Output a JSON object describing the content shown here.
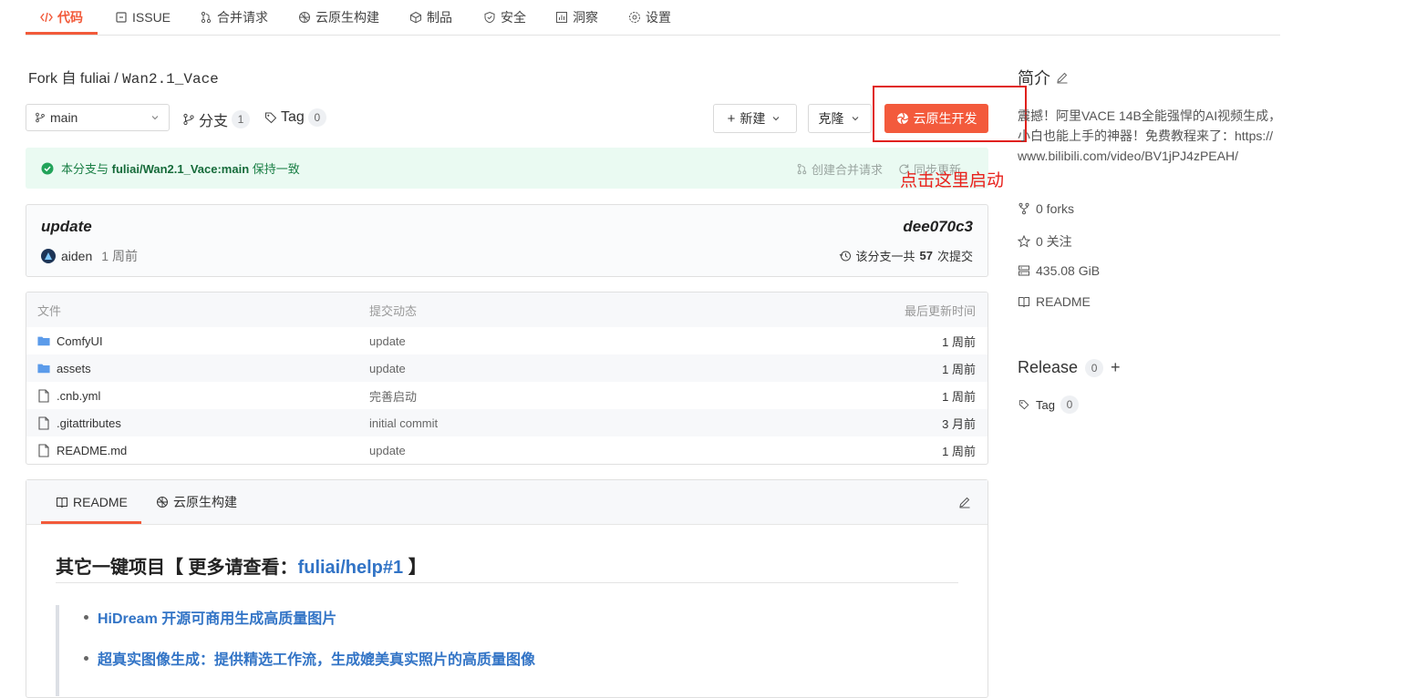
{
  "tabs": [
    {
      "label": "代码",
      "icon": "code-icon"
    },
    {
      "label": "ISSUE",
      "icon": "issue-icon"
    },
    {
      "label": "合并请求",
      "icon": "pull-request-icon"
    },
    {
      "label": "云原生构建",
      "icon": "build-icon"
    },
    {
      "label": "制品",
      "icon": "package-icon"
    },
    {
      "label": "安全",
      "icon": "shield-icon"
    },
    {
      "label": "洞察",
      "icon": "chart-icon"
    },
    {
      "label": "设置",
      "icon": "gear-icon"
    }
  ],
  "repo": {
    "fork_prefix": "Fork 自 ",
    "owner": "fuliai",
    "separator": " / ",
    "name": "Wan2.1_Vace"
  },
  "toolbar": {
    "branch": "main",
    "branches_label": "分支",
    "branches_count": "1",
    "tags_label": "Tag",
    "tags_count": "0",
    "new_label": "新建",
    "clone_label": "克隆",
    "cloud_dev_label": "云原生开发"
  },
  "annotation": "点击这里启动",
  "sync": {
    "prefix": "本分支与 ",
    "target": "fuliai/Wan2.1_Vace:main",
    "suffix": " 保持一致",
    "create_pr": "创建合并请求",
    "sync_update": "同步更新"
  },
  "commit": {
    "message": "update",
    "hash": "dee070c3",
    "author": "aiden",
    "time": "1 周前",
    "count_prefix": "该分支一共",
    "count": "57",
    "count_suffix": "次提交"
  },
  "files": {
    "headers": {
      "name": "文件",
      "message": "提交动态",
      "time": "最后更新时间"
    },
    "rows": [
      {
        "name": "ComfyUI",
        "type": "folder",
        "message": "update",
        "time": "1 周前"
      },
      {
        "name": "assets",
        "type": "folder",
        "message": "update",
        "time": "1 周前"
      },
      {
        "name": ".cnb.yml",
        "type": "file",
        "message": "完善启动",
        "time": "1 周前"
      },
      {
        "name": ".gitattributes",
        "type": "file",
        "message": "initial commit",
        "time": "3 月前"
      },
      {
        "name": "README.md",
        "type": "file",
        "message": "update",
        "time": "1 周前"
      }
    ]
  },
  "readme": {
    "tab_readme": "README",
    "tab_build": "云原生构建",
    "heading_prefix": "其它一键项目【 更多请查看：",
    "heading_link": "fuliai/help#1",
    "heading_suffix": " 】",
    "items": [
      "HiDream 开源可商用生成高质量图片",
      "超真实图像生成：提供精选工作流，生成媲美真实照片的高质量图像"
    ]
  },
  "sidebar": {
    "intro_title": "简介",
    "description": "震撼！阿里VACE 14B全能强悍的AI视频生成，小白也能上手的神器！免费教程来了：https://www.bilibili.com/video/BV1jPJ4zPEAH/",
    "forks": "0 forks",
    "watch": "0 关注",
    "size": "435.08 GiB",
    "readme": "README",
    "release_title": "Release",
    "release_count": "0",
    "tag_label": "Tag",
    "tag_count": "0"
  },
  "colors": {
    "accent": "#f25a3a",
    "highlight": "#e0201c",
    "link": "#3274c6",
    "success": "#1a7f45"
  }
}
